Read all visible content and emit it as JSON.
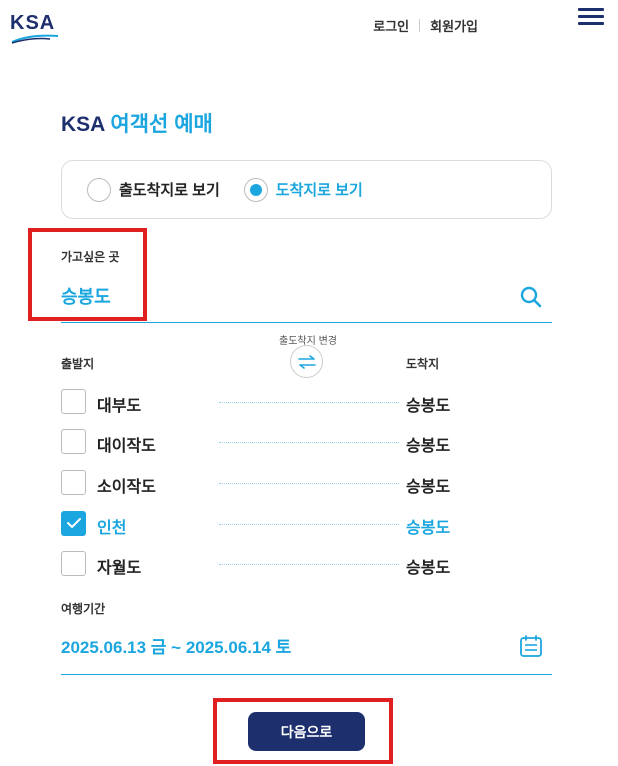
{
  "header": {
    "logo_text": "KSA",
    "login": "로그인",
    "signup": "회원가입"
  },
  "title": {
    "brand": "KSA",
    "rest": "여객선 예매"
  },
  "view_mode": {
    "options": [
      {
        "label": "출도착지로 보기",
        "selected": false
      },
      {
        "label": "도착지로 보기",
        "selected": true
      }
    ]
  },
  "destination": {
    "label": "가고싶은 곳",
    "value": "승봉도"
  },
  "swap": {
    "label": "출도착지 변경"
  },
  "columns": {
    "from": "출발지",
    "to": "도착지"
  },
  "routes": [
    {
      "from": "대부도",
      "to": "승봉도",
      "checked": false
    },
    {
      "from": "대이작도",
      "to": "승봉도",
      "checked": false
    },
    {
      "from": "소이작도",
      "to": "승봉도",
      "checked": false
    },
    {
      "from": "인천",
      "to": "승봉도",
      "checked": true
    },
    {
      "from": "자월도",
      "to": "승봉도",
      "checked": false
    }
  ],
  "period": {
    "label": "여행기간",
    "value": "2025.06.13 금 ~ 2025.06.14 토"
  },
  "next_button": "다음으로",
  "colors": {
    "navy": "#1e2f6e",
    "accent": "#1ba6df",
    "highlight_box": "#e02020"
  },
  "icons": [
    "menu-icon",
    "search-icon",
    "swap-icon",
    "calendar-icon",
    "check-icon"
  ]
}
